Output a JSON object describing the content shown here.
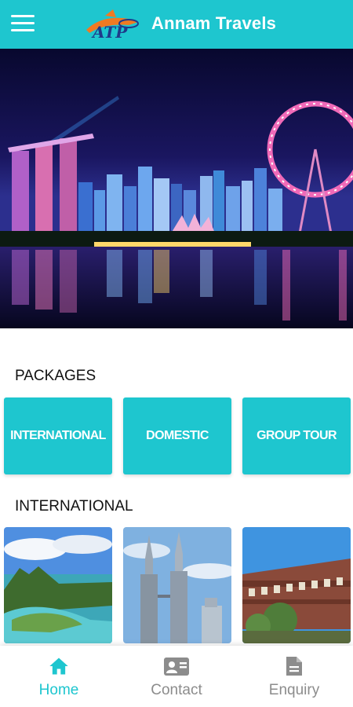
{
  "app_bar": {
    "title": "Annam Travels"
  },
  "sections": {
    "packages_title": "PACKAGES",
    "international_title": "INTERNATIONAL"
  },
  "packages": [
    {
      "label": "INTERNATIONAL"
    },
    {
      "label": "DOMESTIC"
    },
    {
      "label": "GROUP TOUR"
    }
  ],
  "destinations": [
    {
      "icon": "mauritius-island-photo"
    },
    {
      "icon": "petronas-towers-photo"
    },
    {
      "icon": "heritage-building-photo"
    }
  ],
  "bottom_nav": [
    {
      "label": "Home",
      "icon": "home-icon",
      "active": true
    },
    {
      "label": "Contact",
      "icon": "contact-card-icon",
      "active": false
    },
    {
      "label": "Enquiry",
      "icon": "document-icon",
      "active": false
    }
  ],
  "colors": {
    "accent": "#1ec6cf",
    "inactive": "#8c8c8c"
  }
}
